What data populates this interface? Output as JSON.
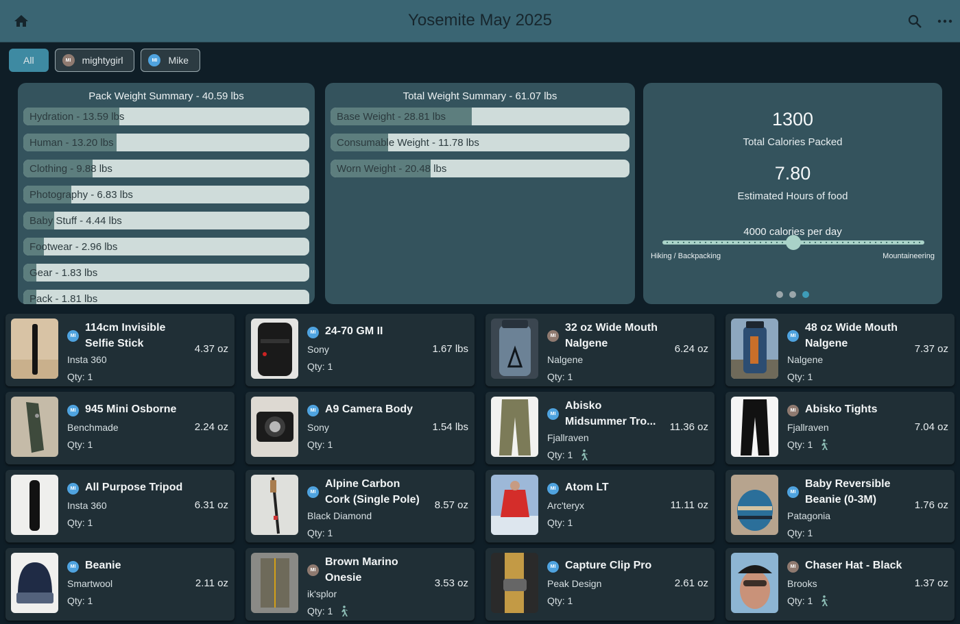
{
  "appbar": {
    "title": "Yosemite May 2025"
  },
  "filters": [
    {
      "label": "All",
      "avatar": "",
      "active": true
    },
    {
      "label": "mightygirl",
      "avatar": "MI",
      "color": "brown"
    },
    {
      "label": "Mike",
      "avatar": "MI",
      "color": "blue"
    }
  ],
  "pack_summary": {
    "title": "Pack Weight Summary - 40.59 lbs",
    "bars": [
      {
        "label": "Hydration - 13.59 lbs",
        "fraction": 0.335
      },
      {
        "label": "Human - 13.20 lbs",
        "fraction": 0.325
      },
      {
        "label": "Clothing - 9.88 lbs",
        "fraction": 0.243
      },
      {
        "label": "Photography - 6.83 lbs",
        "fraction": 0.168
      },
      {
        "label": "Baby Stuff - 4.44 lbs",
        "fraction": 0.109
      },
      {
        "label": "Footwear - 2.96 lbs",
        "fraction": 0.073
      },
      {
        "label": "Gear - 1.83 lbs",
        "fraction": 0.045
      },
      {
        "label": "Pack - 1.81 lbs",
        "fraction": 0.045
      }
    ]
  },
  "total_summary": {
    "title": "Total Weight Summary - 61.07 lbs",
    "bars": [
      {
        "label": "Base Weight - 28.81 lbs",
        "fraction": 0.472
      },
      {
        "label": "Consumable Weight - 11.78 lbs",
        "fraction": 0.193
      },
      {
        "label": "Worn Weight - 20.48 lbs",
        "fraction": 0.335
      }
    ]
  },
  "calories": {
    "total": "1300",
    "total_label": "Total Calories Packed",
    "hours": "7.80",
    "hours_label": "Estimated Hours of food",
    "slider_label": "4000 calories per day",
    "slider_value": 0.5,
    "min_label": "Hiking / Backpacking",
    "max_label": "Mountaineering"
  },
  "items": [
    {
      "name": "114cm Invisible Selfie Stick",
      "brand": "Insta 360",
      "qty": "Qty: 1",
      "weight": "4.37 oz",
      "owner": "blue",
      "lines": 2,
      "worn": false,
      "img": "stick"
    },
    {
      "name": "24-70 GM II",
      "brand": "Sony",
      "qty": "Qty: 1",
      "weight": "1.67 lbs",
      "owner": "blue",
      "lines": 1,
      "worn": false,
      "img": "lens"
    },
    {
      "name": "32 oz Wide Mouth Nalgene",
      "brand": "Nalgene",
      "qty": "Qty: 1",
      "weight": "6.24 oz",
      "owner": "brown",
      "lines": 2,
      "worn": false,
      "img": "bottle"
    },
    {
      "name": "48 oz Wide Mouth Nalgene",
      "brand": "Nalgene",
      "qty": "Qty: 1",
      "weight": "7.37 oz",
      "owner": "blue",
      "lines": 2,
      "worn": false,
      "img": "bottle2"
    },
    {
      "name": "945 Mini Osborne",
      "brand": "Benchmade",
      "qty": "Qty: 1",
      "weight": "2.24 oz",
      "owner": "blue",
      "lines": 1,
      "worn": false,
      "img": "knife"
    },
    {
      "name": "A9 Camera Body",
      "brand": "Sony",
      "qty": "Qty: 1",
      "weight": "1.54 lbs",
      "owner": "blue",
      "lines": 1,
      "worn": false,
      "img": "camera"
    },
    {
      "name": "Abisko Midsummer Tro...",
      "brand": "Fjallraven",
      "qty": "Qty: 1",
      "weight": "11.36 oz",
      "owner": "blue",
      "lines": 2,
      "worn": true,
      "img": "pants"
    },
    {
      "name": "Abisko Tights",
      "brand": "Fjallraven",
      "qty": "Qty: 1",
      "weight": "7.04 oz",
      "owner": "brown",
      "lines": 1,
      "worn": true,
      "img": "tights"
    },
    {
      "name": "All Purpose Tripod",
      "brand": "Insta 360",
      "qty": "Qty: 1",
      "weight": "6.31 oz",
      "owner": "blue",
      "lines": 1,
      "worn": false,
      "img": "tripod"
    },
    {
      "name": "Alpine Carbon Cork (Single Pole)",
      "brand": "Black Diamond",
      "qty": "Qty: 1",
      "weight": "8.57 oz",
      "owner": "blue",
      "lines": 2,
      "worn": false,
      "img": "pole"
    },
    {
      "name": "Atom LT",
      "brand": "Arc'teryx",
      "qty": "Qty: 1",
      "weight": "11.11 oz",
      "owner": "blue",
      "lines": 1,
      "worn": false,
      "img": "jacket"
    },
    {
      "name": "Baby Reversible Beanie (0-3M)",
      "brand": "Patagonia",
      "qty": "Qty: 1",
      "weight": "1.76 oz",
      "owner": "blue",
      "lines": 2,
      "worn": false,
      "img": "babybeanie"
    },
    {
      "name": "Beanie",
      "brand": "Smartwool",
      "qty": "Qty: 1",
      "weight": "2.11 oz",
      "owner": "blue",
      "lines": 1,
      "worn": false,
      "img": "beanie"
    },
    {
      "name": "Brown Marino Onesie",
      "brand": "ik'splor",
      "qty": "Qty: 1",
      "weight": "3.53 oz",
      "owner": "brown",
      "lines": 2,
      "worn": true,
      "img": "onesie"
    },
    {
      "name": "Capture Clip Pro",
      "brand": "Peak Design",
      "qty": "Qty: 1",
      "weight": "2.61 oz",
      "owner": "blue",
      "lines": 1,
      "worn": false,
      "img": "clip"
    },
    {
      "name": "Chaser Hat - Black",
      "brand": "Brooks",
      "qty": "Qty: 1",
      "weight": "1.37 oz",
      "owner": "brown",
      "lines": 1,
      "worn": true,
      "img": "hat"
    }
  ],
  "avatar_text": "MI"
}
